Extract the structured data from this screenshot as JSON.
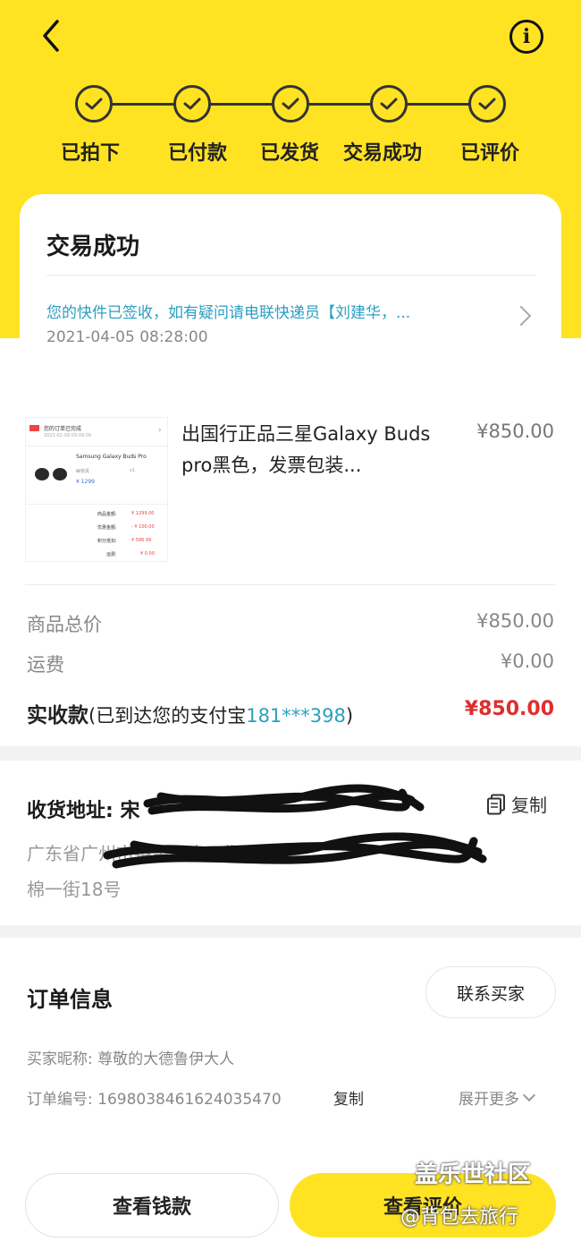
{
  "steps": [
    {
      "label": "已拍下"
    },
    {
      "label": "已付款"
    },
    {
      "label": "已发货"
    },
    {
      "label": "交易成功"
    },
    {
      "label": "已评价"
    }
  ],
  "status": {
    "title": "交易成功",
    "logistics_text": "您的快件已签收，如有疑问请电联快递员【刘建华，...",
    "logistics_time": "2021-04-05 08:28:00"
  },
  "product": {
    "title": "出国行正品三星Galaxy Buds pro黑色，发票包装...",
    "price": "¥850.00",
    "thumb": {
      "header_text": "您的订单已完成",
      "header_time": "2021-02-09 09:09:09",
      "item_name": "Samsung Galaxy Buds Pro",
      "item_variant": "幽夜黑",
      "item_qty": "x1",
      "item_price": "¥ 1299",
      "rows": [
        {
          "label": "商品金额:",
          "value": "¥ 1299.00"
        },
        {
          "label": "优惠金额:",
          "value": "- ¥ 100.00"
        },
        {
          "label": "积分抵扣:",
          "value": "¥ 566.99"
        },
        {
          "label": "运费:",
          "value": "¥ 0.00"
        }
      ]
    }
  },
  "summary": {
    "total_label": "商品总价",
    "total_value": "¥850.00",
    "shipping_label": "运费",
    "shipping_value": "¥0.00",
    "paid_label": "实收款",
    "paid_note_prefix": "(已到达您的支付宝",
    "paid_account": "181***398",
    "paid_note_suffix": ")",
    "paid_amount": "¥850.00"
  },
  "address": {
    "title": "收货地址: 宋",
    "copy_label": "复制",
    "line1": "广东省广州市番禺区大石街道",
    "line2": "棉一街18号"
  },
  "order": {
    "title": "订单信息",
    "contact_label": "联系买家",
    "buyer_line": "买家昵称: 尊敬的大德鲁伊大人",
    "order_no_line": "订单编号: 1698038461624035470",
    "copy_label": "复制",
    "expand_label": "展开更多"
  },
  "actions": {
    "view_money": "查看钱款",
    "view_review": "查看评价"
  },
  "watermark": {
    "line1": "盖乐世社区",
    "line2": "@背包去旅行"
  },
  "colors": {
    "brand_yellow": "#ffe323",
    "link_blue": "#2b9fc0",
    "price_red": "#e02d2d"
  }
}
